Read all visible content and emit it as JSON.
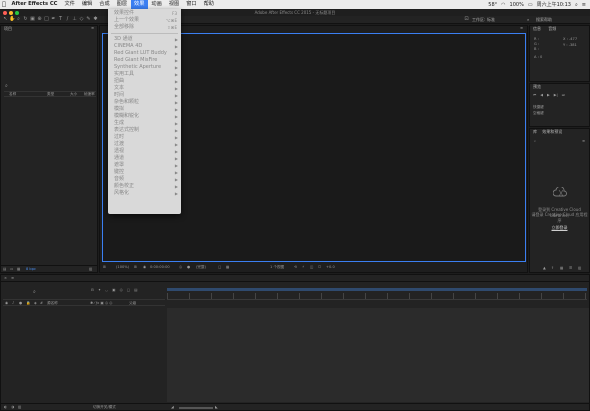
{
  "menubar": {
    "apple": "",
    "items": [
      "After Effects CC",
      "文件",
      "编辑",
      "合成",
      "图层",
      "效果",
      "动画",
      "视图",
      "窗口",
      "帮助"
    ],
    "status_battle": "58°",
    "status_time": "周六上午10:13",
    "status_battery": "100%"
  },
  "window": {
    "title": "Adobe After Effects CC 2015 - 无标题项目"
  },
  "toolbar": {
    "workspace_label": "工作区:",
    "workspace_value": "标准",
    "search_placeholder": "搜索帮助"
  },
  "project_panel": {
    "title": "项目",
    "col_name": "名称",
    "col_type": "类型",
    "col_size": "大小",
    "col_rate": "帧速率",
    "bpc": "8 bpc"
  },
  "info_panel": {
    "tab_info": "信息",
    "tab_audio": "音频",
    "r": "R :",
    "g": "G :",
    "b": "B :",
    "a": "A : 0",
    "x": "X : -477",
    "y": "Y : -381"
  },
  "preview_panel": {
    "title": "预览",
    "shortcut_label": "快捷键",
    "shortcut_value": "空格键"
  },
  "effects_panel": {
    "tab_effects": "效果和预设",
    "tab_lib": "库"
  },
  "cc_library": {
    "line1": "登录到 Creative Cloud Libraries,",
    "line2": "请登录 Creative Cloud 应用程序",
    "link": "立即登录"
  },
  "comp_footer": {
    "zoom": "(100%)",
    "timecode": "0:00:00:00",
    "quality": "(完整)",
    "view": "1 个视图",
    "offset": "+0.0"
  },
  "timeline": {
    "source_col": "源名称",
    "parent_col": "父级",
    "toggle_label": "切换开关/模式"
  },
  "dropdown": {
    "items": [
      {
        "label": "效果控件",
        "shortcut": "F3",
        "arrow": false
      },
      {
        "label": "上一个效果",
        "shortcut": "⌥⌘E",
        "arrow": false
      },
      {
        "label": "全部移除",
        "shortcut": "⇧⌘E",
        "arrow": false
      },
      {
        "label": "3D 通道",
        "arrow": true
      },
      {
        "label": "CINEMA 4D",
        "arrow": true
      },
      {
        "label": "Red Giant LUT Buddy",
        "arrow": true
      },
      {
        "label": "Red Giant MisFire",
        "arrow": true
      },
      {
        "label": "Synthetic Aperture",
        "arrow": true
      },
      {
        "label": "实用工具",
        "arrow": true
      },
      {
        "label": "扭曲",
        "arrow": true
      },
      {
        "label": "文本",
        "arrow": true
      },
      {
        "label": "时间",
        "arrow": true
      },
      {
        "label": "杂色和颗粒",
        "arrow": true
      },
      {
        "label": "模拟",
        "arrow": true
      },
      {
        "label": "模糊和锐化",
        "arrow": true
      },
      {
        "label": "生成",
        "arrow": true
      },
      {
        "label": "表达式控制",
        "arrow": true
      },
      {
        "label": "过时",
        "arrow": true
      },
      {
        "label": "过渡",
        "arrow": true
      },
      {
        "label": "透视",
        "arrow": true
      },
      {
        "label": "通道",
        "arrow": true
      },
      {
        "label": "遮罩",
        "arrow": true
      },
      {
        "label": "键控",
        "arrow": true
      },
      {
        "label": "音频",
        "arrow": true
      },
      {
        "label": "颜色校正",
        "arrow": true
      },
      {
        "label": "风格化",
        "arrow": true
      }
    ]
  }
}
